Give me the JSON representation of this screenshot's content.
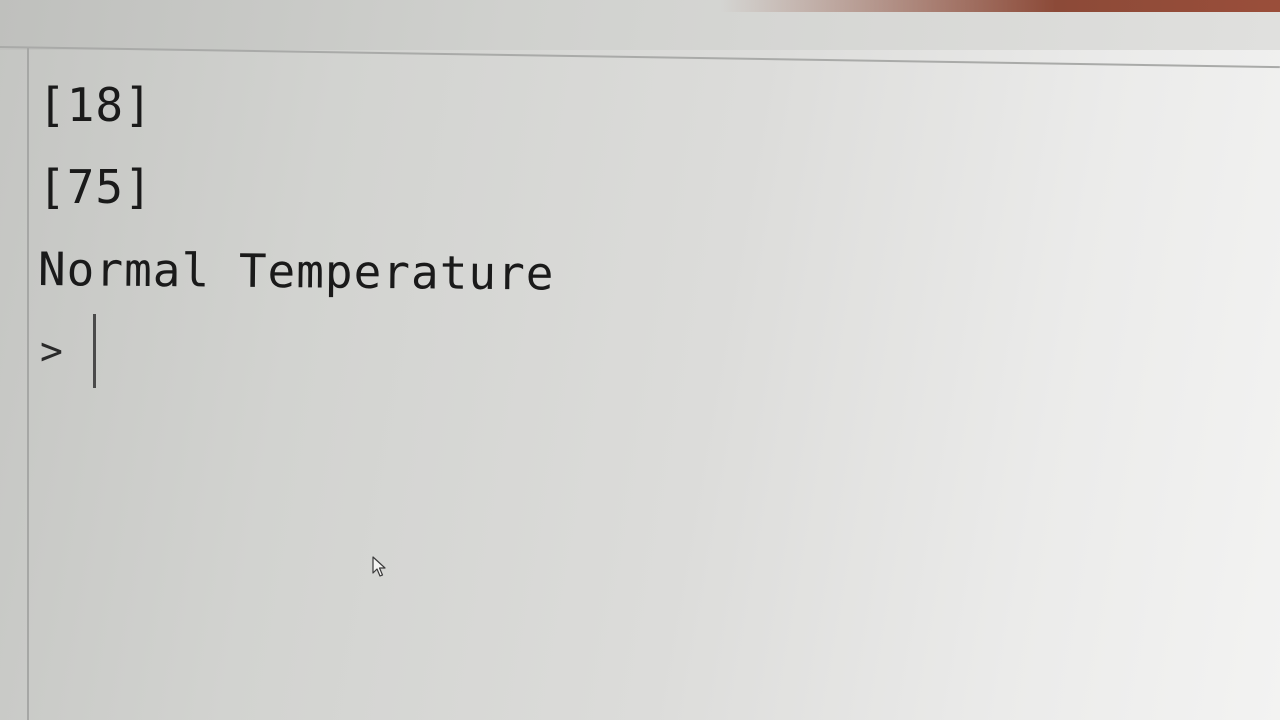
{
  "console": {
    "output_lines": [
      "[18]",
      "[75]",
      "Normal Temperature"
    ],
    "prompt": ">"
  },
  "colors": {
    "background": "#d6d7d4",
    "text": "#1a1a1a",
    "accent": "#8c4a38"
  },
  "icons": {
    "mouse_pointer": "arrow-pointer-icon"
  }
}
